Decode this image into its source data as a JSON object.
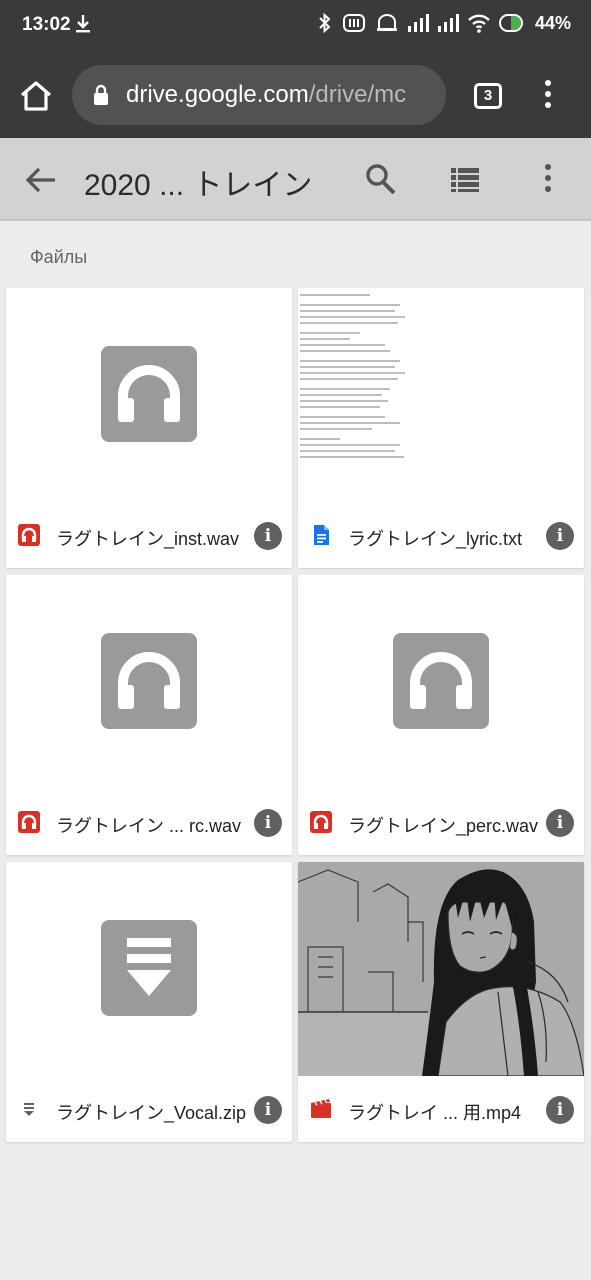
{
  "status_bar": {
    "time": "13:02",
    "battery": "44%"
  },
  "browser": {
    "url_host": "drive.google.com",
    "url_path": "/drive/mc",
    "tab_count": "3"
  },
  "toolbar": {
    "title": "2020 ... トレイン"
  },
  "section_label": "Файлы",
  "colors": {
    "audio": "#d93025",
    "doc": "#1a73e8",
    "video": "#d93025",
    "zip": "#5f6368",
    "placeholder": "#9a9a9a"
  },
  "files": [
    {
      "name": "ラグトレイン_inst.wav",
      "type": "audio",
      "icon": "headphones-icon"
    },
    {
      "name": "ラグトレイン_lyric.txt",
      "type": "doc",
      "icon": "doc-icon"
    },
    {
      "name": "ラグトレイン ... rc.wav",
      "type": "audio",
      "icon": "headphones-icon"
    },
    {
      "name": "ラグトレイン_perc.wav",
      "type": "audio",
      "icon": "headphones-icon"
    },
    {
      "name": "ラグトレイン_Vocal.zip",
      "type": "zip",
      "icon": "zip-icon"
    },
    {
      "name": "ラグトレイ ... 用.mp4",
      "type": "video",
      "icon": "video-icon"
    }
  ]
}
